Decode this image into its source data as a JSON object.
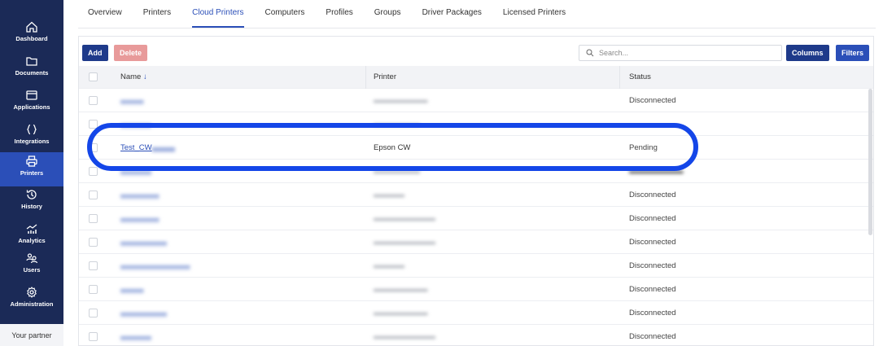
{
  "sidebar": {
    "items": [
      {
        "label": "Dashboard",
        "icon": "home-icon"
      },
      {
        "label": "Documents",
        "icon": "folder-icon"
      },
      {
        "label": "Applications",
        "icon": "window-icon"
      },
      {
        "label": "Integrations",
        "icon": "braces-icon"
      },
      {
        "label": "Printers",
        "icon": "printer-icon",
        "active": true
      },
      {
        "label": "History",
        "icon": "history-icon"
      },
      {
        "label": "Analytics",
        "icon": "analytics-icon"
      },
      {
        "label": "Users",
        "icon": "users-icon"
      },
      {
        "label": "Administration",
        "icon": "gear-icon"
      }
    ],
    "footer": "Your partner"
  },
  "tabs": [
    "Overview",
    "Printers",
    "Cloud Printers",
    "Computers",
    "Profiles",
    "Groups",
    "Driver Packages",
    "Licensed Printers"
  ],
  "active_tab": "Cloud Printers",
  "toolbar": {
    "add": "Add",
    "delete": "Delete",
    "search_placeholder": "Search...",
    "columns": "Columns",
    "filters": "Filters"
  },
  "table": {
    "headers": {
      "name": "Name",
      "printer": "Printer",
      "status": "Status"
    },
    "sort_indicator": "↓",
    "rows": [
      {
        "name": "",
        "printer": "",
        "status": "Disconnected"
      },
      {
        "name": "",
        "printer": "",
        "status": ""
      },
      {
        "name": "Test_CW",
        "printer": "Epson CW",
        "status": "Pending"
      },
      {
        "name": "",
        "printer": "",
        "status": ""
      },
      {
        "name": "",
        "printer": "",
        "status": "Disconnected"
      },
      {
        "name": "",
        "printer": "",
        "status": "Disconnected"
      },
      {
        "name": "",
        "printer": "",
        "status": "Disconnected"
      },
      {
        "name": "",
        "printer": "",
        "status": "Disconnected"
      },
      {
        "name": "",
        "printer": "",
        "status": "Disconnected"
      },
      {
        "name": "",
        "printer": "",
        "status": "Disconnected"
      },
      {
        "name": "",
        "printer": "",
        "status": "Disconnected"
      }
    ]
  },
  "colors": {
    "sidebar_bg": "#1b2a57",
    "accent": "#2b4fb8",
    "primary_button": "#1e3a8a",
    "delete_button": "#e89a9a",
    "highlight": "#1446e8"
  }
}
